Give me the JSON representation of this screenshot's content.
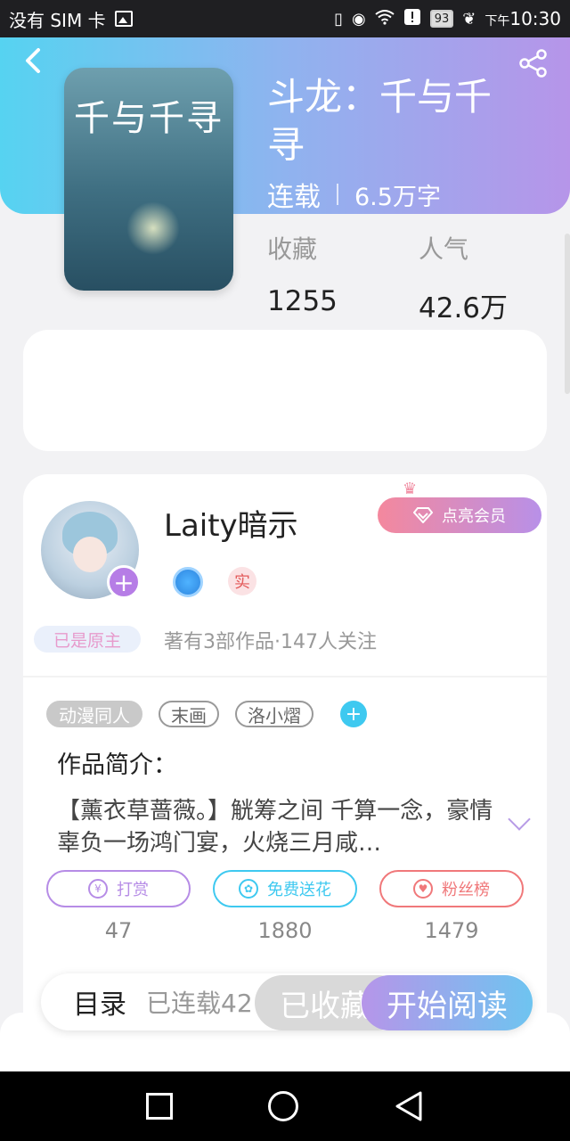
{
  "status_bar": {
    "carrier": "没有 SIM 卡",
    "battery": "93",
    "time_prefix": "下午",
    "time": "10:30"
  },
  "book": {
    "title": "斗龙：千与千寻",
    "cover_text": "千与千寻",
    "status": "连载",
    "word_count": "6.5万字",
    "favorites_label": "收藏",
    "favorites_value": "1255",
    "popularity_label": "人气",
    "popularity_value": "42.6万"
  },
  "author": {
    "name": "Laity暗示",
    "owner_badge": "已是原主",
    "vip_button": "点亮会员",
    "real_badge": "实",
    "stats": "著有3部作品·147人关注"
  },
  "tags": [
    "动漫同人",
    "末画",
    "洛小熠"
  ],
  "intro": {
    "title": "作品简介：",
    "text": "【薰衣草蔷薇。】觥筹之间 千算一念，豪情辜负一场鸿门宴，火烧三月咸…"
  },
  "actions": [
    {
      "label": "打赏",
      "count": "47",
      "color": "#b68ce6"
    },
    {
      "label": "免费送花",
      "count": "1880",
      "color": "#3ec9f0"
    },
    {
      "label": "粉丝榜",
      "count": "1479",
      "color": "#f0787a"
    }
  ],
  "bottom": {
    "toc_label": "目录",
    "toc_status": "已连载42",
    "collected_label": "已收藏",
    "read_label": "开始阅读"
  }
}
